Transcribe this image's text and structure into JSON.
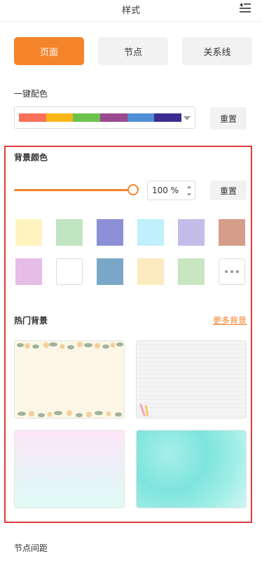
{
  "header": {
    "title": "样式"
  },
  "tabs": [
    {
      "label": "页面",
      "active": true
    },
    {
      "label": "节点",
      "active": false
    },
    {
      "label": "关系线",
      "active": false
    }
  ],
  "one_click_color": {
    "label": "一键配色",
    "palette": [
      "#f9705a",
      "#f9b71a",
      "#6cc24a",
      "#9b4a8f",
      "#4f8fd6",
      "#3d2c91"
    ],
    "reset_label": "重置"
  },
  "background_color": {
    "label": "背景颜色",
    "opacity_percent": 100,
    "opacity_text": "100 %",
    "reset_label": "重置",
    "swatches_row1": [
      "#fff4bf",
      "#c2e5c1",
      "#8d8fd6",
      "#bff0fb",
      "#c4bce8",
      "#d69d8b"
    ],
    "swatches_row2": [
      "#e5bde6",
      "#ffffff",
      "#7aa7c7",
      "#fdebc0",
      "#c8e6c0"
    ],
    "more_icon": "ellipsis-icon"
  },
  "hot_backgrounds": {
    "label": "热门背景",
    "more_link": "更多背景",
    "items": [
      "floral",
      "paper-lines",
      "pink-gradient",
      "cyan-watercolor"
    ]
  },
  "node_spacing": {
    "label": "节点间距"
  },
  "colors": {
    "accent": "#f5832a",
    "highlight_border": "#e03a3a"
  }
}
